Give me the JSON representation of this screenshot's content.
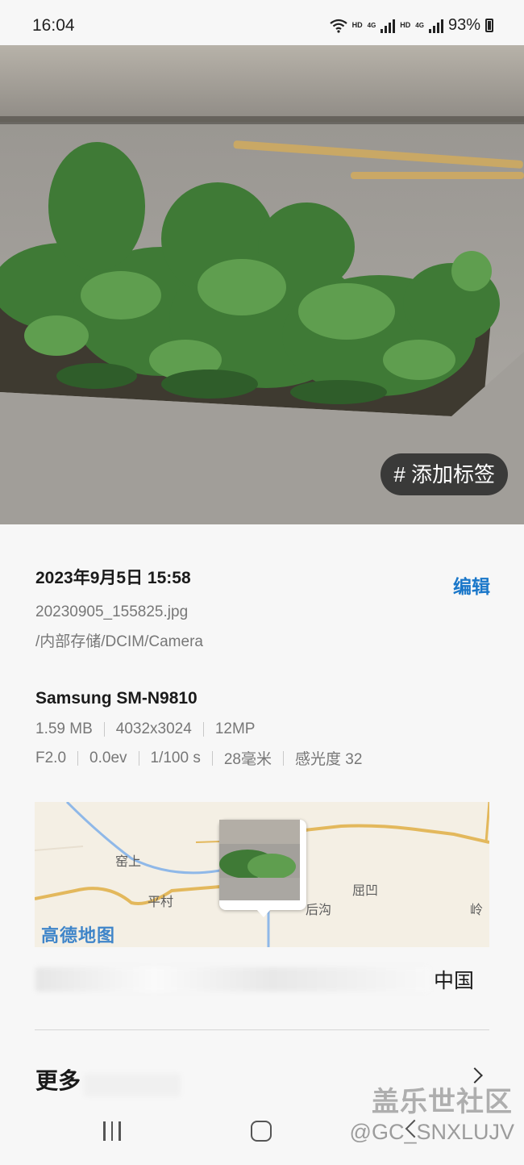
{
  "status_bar": {
    "time": "16:04",
    "hd1": "HD",
    "net1": "4G",
    "hd2": "HD",
    "net2": "4G",
    "battery": "93%"
  },
  "photo": {
    "tag_button": "# 添加标签"
  },
  "details": {
    "date": "2023年9月5日 15:58",
    "edit_label": "编辑",
    "filename": "20230905_155825.jpg",
    "path": "/内部存储/DCIM/Camera",
    "device": "Samsung SM-N9810",
    "size": "1.59 MB",
    "resolution": "4032x3024",
    "megapixels": "12MP",
    "aperture": "F2.0",
    "exposure": "0.0ev",
    "shutter": "1/100 s",
    "focal": "28毫米",
    "iso": "感光度 32"
  },
  "map": {
    "logo": "高德地图",
    "labels": [
      "窑上",
      "平村",
      "屈凹",
      "后沟",
      "岭"
    ],
    "address_suffix": "中国"
  },
  "more": {
    "label": "更多"
  },
  "watermark": {
    "brand": "盖乐世社区",
    "handle": "@GC_SNXLUJV"
  }
}
